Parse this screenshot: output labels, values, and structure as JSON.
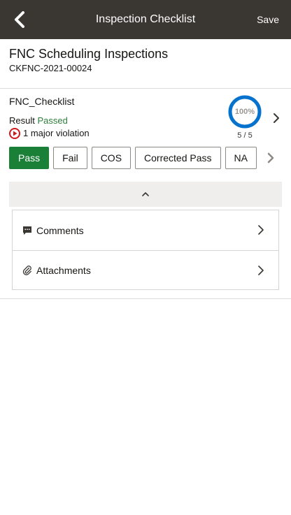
{
  "header": {
    "title": "Inspection Checklist",
    "save_label": "Save"
  },
  "record": {
    "title": "FNC Scheduling Inspections",
    "id": "CKFNC-2021-00024"
  },
  "checklist": {
    "name": "FNC_Checklist",
    "result_label": "Result",
    "result_value": "Passed",
    "violation_text": "1 major violation",
    "progress_percent": 100,
    "progress_text": "100%",
    "progress_count": "5 / 5"
  },
  "result_buttons": [
    "Pass",
    "Fail",
    "COS",
    "Corrected Pass",
    "NA"
  ],
  "selected_result": "Pass",
  "panel": {
    "comments_label": "Comments",
    "attachments_label": "Attachments"
  },
  "colors": {
    "header_bg": "#3a3632",
    "pass_green": "#1a7f37",
    "passed_text": "#2e7d3b",
    "progress_ring": "#0572ce",
    "violation_red": "#d0181f"
  },
  "icons": {
    "back": "chevron-left-icon",
    "violation": "violation-play-icon",
    "comments": "comment-icon",
    "attachments": "paperclip-icon"
  }
}
